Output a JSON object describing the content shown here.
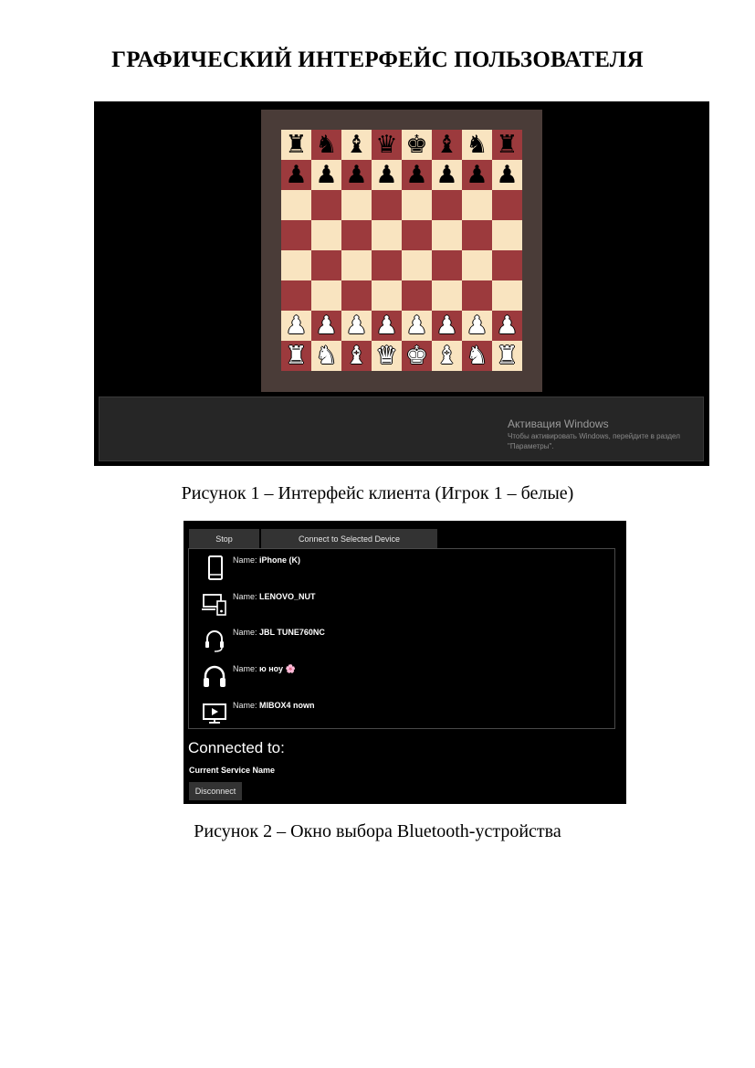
{
  "heading": "ГРАФИЧЕСКИЙ ИНТЕРФЕЙС ПОЛЬЗОВАТЕЛЯ",
  "figure1": {
    "caption": "Рисунок 1 – Интерфейс клиента (Игрок 1 – белые)",
    "board": {
      "rows": [
        [
          "r",
          "n",
          "b",
          "q",
          "k",
          "b",
          "n",
          "r"
        ],
        [
          "p",
          "p",
          "p",
          "p",
          "p",
          "p",
          "p",
          "p"
        ],
        [
          "",
          "",
          "",
          "",
          "",
          "",
          "",
          ""
        ],
        [
          "",
          "",
          "",
          "",
          "",
          "",
          "",
          ""
        ],
        [
          "",
          "",
          "",
          "",
          "",
          "",
          "",
          ""
        ],
        [
          "",
          "",
          "",
          "",
          "",
          "",
          "",
          ""
        ],
        [
          "P",
          "P",
          "P",
          "P",
          "P",
          "P",
          "P",
          "P"
        ],
        [
          "R",
          "N",
          "B",
          "Q",
          "K",
          "B",
          "N",
          "R"
        ]
      ],
      "light_color": "#f9e4c0",
      "dark_color": "#9c3a3d",
      "frame_color": "#4a3c38"
    },
    "watermark": {
      "title": "Активация Windows",
      "subtitle": "Чтобы активировать Windows, перейдите в раздел \"Параметры\"."
    }
  },
  "figure2": {
    "caption": "Рисунок 2 – Окно выбора Bluetooth-устройства",
    "buttons": {
      "stop": "Stop",
      "connect": "Connect to Selected Device",
      "disconnect": "Disconnect"
    },
    "name_label": "Name:",
    "devices": [
      {
        "icon": "phone-icon",
        "name": "iPhone (K)"
      },
      {
        "icon": "computer-icon",
        "name": "LENOVO_NUT"
      },
      {
        "icon": "headset-icon",
        "name": "JBL TUNE760NC"
      },
      {
        "icon": "headphones-icon",
        "name": "ю ноу 🌸"
      },
      {
        "icon": "tv-icon",
        "name": "MIBOX4 nown"
      }
    ],
    "connected_title": "Connected to:",
    "service_name": "Current Service Name"
  }
}
